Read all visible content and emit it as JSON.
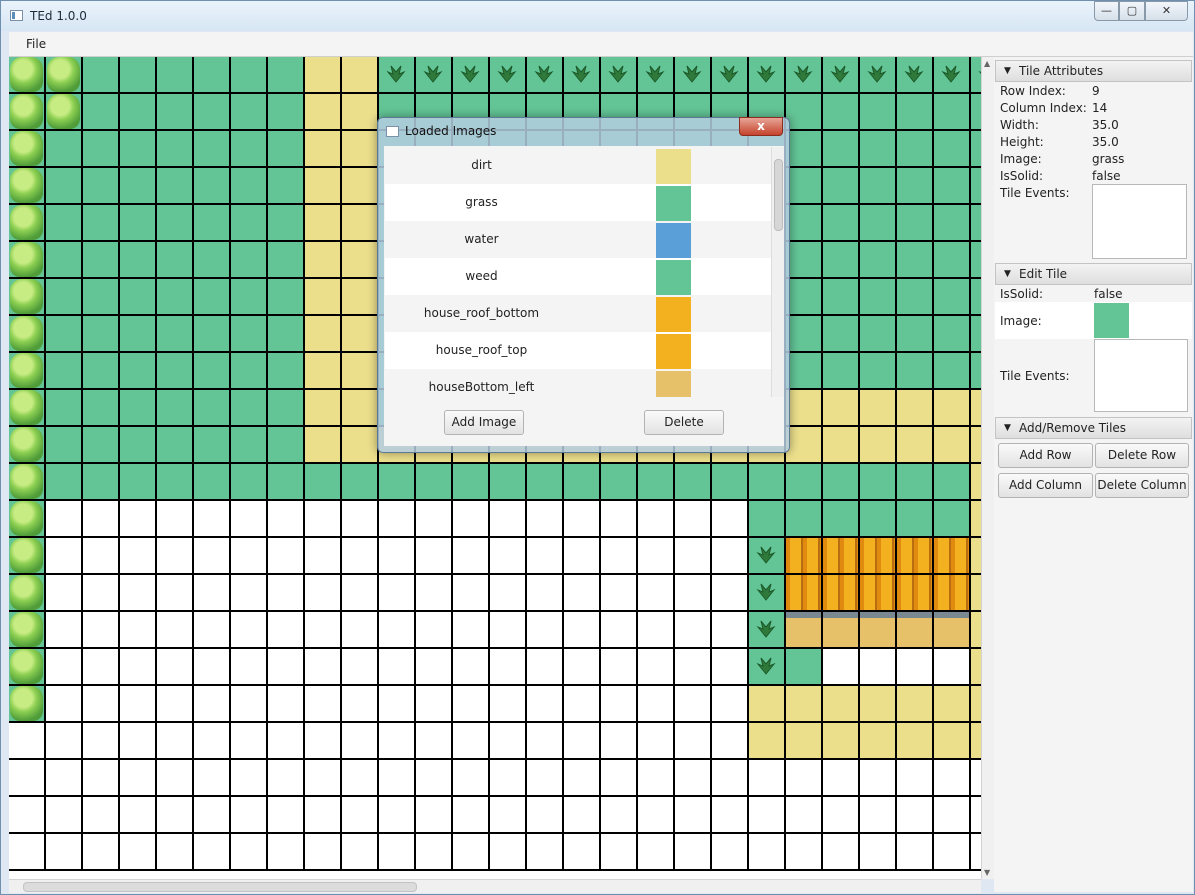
{
  "window": {
    "title": "TEd 1.0.0",
    "min": "—",
    "max": "▢",
    "close": "✕"
  },
  "menu": {
    "file": "File"
  },
  "tiles": {
    "colors": {
      "grass": "#63c596",
      "dirt": "#ecdf8c",
      "water": "#5b9fd9",
      "white": "#ffffff"
    },
    "rows": [
      "TTGGGGGGDDWWWWWWWWWWWWWWWWW",
      "TTGGGGGGDDGGGGGGGGGGGGGGGGG",
      "TGGGGGGGDDGGGGGGGGGGGGGGGGG",
      "TGGGGGGGDDGGGGGGGGGGGGGGGGG",
      "TGGGGGGGDDGGGGGGGGGGGGGGGGG",
      "TGGGGGGGDDGGGGGGGGGGGGGGGGG",
      "TGGGGGGGDDGGGGGGGGGGGGGGGGG",
      "TGGGGGGGDDGGGGGGGGGGGGGGGGG",
      "TGGGGGGGDDGGGGGGGGGGGGGGGGG",
      "TGGGGGGGDDGGGGGGGGGGDDDDDDD",
      "TGGGGGGGDDDDDDDDDDDDDDDDDDD",
      "TGGGGGGGGGGGGGGGGGGGGGGGGGD",
      "TXXXXXXXXXXXXXXXXXXXGGGGGGD",
      "TXXXXXXXXXXXXXXXXXXXWRRRRRD",
      "TXXXXXXXXXXXXXXXXXXXWRRRRRD",
      "TXXXXXXXXXXXXXXXXXXXWHHHHHD",
      "TXXXXXXXXXXXXXXXXXXXWGXXXXD",
      "TXXXXXXXXXXXXXXXXXXXDDDDDDD",
      "XXXXXXXXXXXXXXXXXXXXDDDDDDD",
      "XXXXXXXXXXXXXXXXXXXXXXXXXXX",
      "XXXXXXXXXXXXXXXXXXXXXXXXXXX",
      "XXXXXXXXXXXXXXXXXXXXXXXXXXX"
    ]
  },
  "tile_attributes": {
    "header": "Tile Attributes",
    "row_index_label": "Row Index:",
    "row_index": "9",
    "column_index_label": "Column Index:",
    "column_index": "14",
    "width_label": "Width:",
    "width": "35.0",
    "height_label": "Height:",
    "height": "35.0",
    "image_label": "Image:",
    "image": "grass",
    "issolid_label": "IsSolid:",
    "issolid": "false",
    "tile_events_label": "Tile Events:"
  },
  "edit_tile": {
    "header": "Edit Tile",
    "issolid_label": "IsSolid:",
    "issolid": "false",
    "image_label": "Image:",
    "tile_events_label": "Tile Events:"
  },
  "add_remove": {
    "header": "Add/Remove Tiles",
    "add_row": "Add Row",
    "delete_row": "Delete Row",
    "add_column": "Add Column",
    "delete_column": "Delete Column"
  },
  "dialog": {
    "title": "Loaded Images",
    "close": "x",
    "items": [
      {
        "name": "dirt",
        "color": "#ecdf8c"
      },
      {
        "name": "grass",
        "color": "#63c596"
      },
      {
        "name": "water",
        "color": "#5b9fd9"
      },
      {
        "name": "weed",
        "color": "#63c596"
      },
      {
        "name": "house_roof_bottom",
        "color": "#f3b120"
      },
      {
        "name": "house_roof_top",
        "color": "#f3b120"
      },
      {
        "name": "houseBottom_left",
        "color": "#e7c06a"
      }
    ],
    "add_image": "Add Image",
    "delete": "Delete"
  }
}
